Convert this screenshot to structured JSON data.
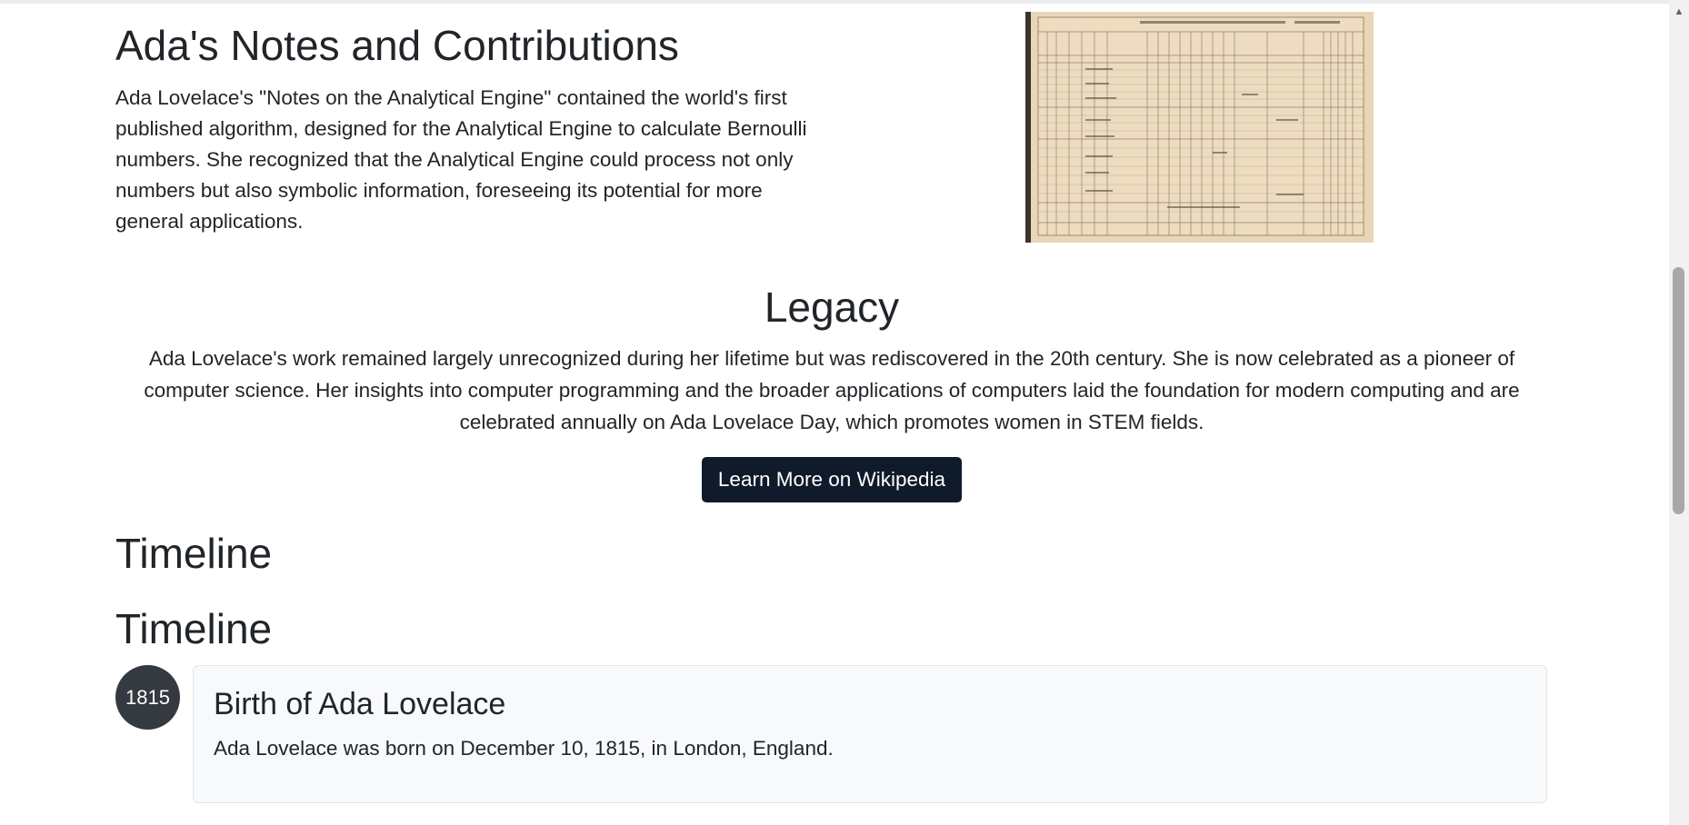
{
  "notes": {
    "title": "Ada's Notes and Contributions",
    "body": "Ada Lovelace's \"Notes on the Analytical Engine\" contained the world's first published algorithm, designed for the Analytical Engine to calculate Bernoulli numbers. She recognized that the Analytical Engine could process not only numbers but also symbolic information, foreseeing its potential for more general applications."
  },
  "legacy": {
    "title": "Legacy",
    "body": "Ada Lovelace's work remained largely unrecognized during her lifetime but was rediscovered in the 20th century. She is now celebrated as a pioneer of computer science. Her insights into computer programming and the broader applications of computers laid the foundation for modern computing and are celebrated annually on Ada Lovelace Day, which promotes women in STEM fields.",
    "button_label": "Learn More on Wikipedia"
  },
  "timeline": {
    "heading_outer": "Timeline",
    "heading_inner": "Timeline",
    "events": [
      {
        "year": "1815",
        "title": "Birth of Ada Lovelace",
        "description": "Ada Lovelace was born on December 10, 1815, in London, England."
      }
    ]
  },
  "icons": {
    "scroll_up": "triangle-up-icon"
  },
  "colors": {
    "button_bg": "#0f1a2b",
    "badge_bg": "#343a40",
    "card_bg": "#f8f9fa",
    "text": "#212529"
  }
}
